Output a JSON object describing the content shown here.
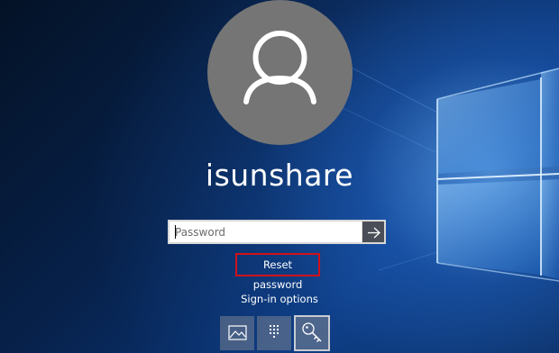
{
  "user": {
    "name": "isunshare"
  },
  "password": {
    "placeholder": "Password",
    "value": ""
  },
  "reset": {
    "label": "Reset password"
  },
  "signin": {
    "label": "Sign-in options",
    "options": [
      {
        "icon": "picture-icon"
      },
      {
        "icon": "pin-keypad-icon"
      },
      {
        "icon": "key-icon",
        "selected": true
      }
    ]
  },
  "colors": {
    "avatar": "#757575",
    "highlight": "#d0121b",
    "submit_bg": "#4a4f57"
  }
}
